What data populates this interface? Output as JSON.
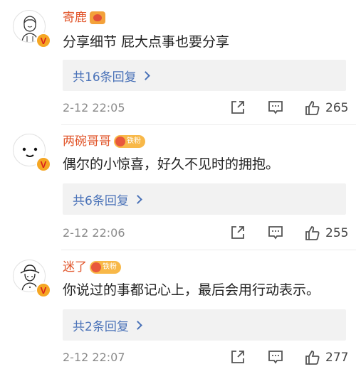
{
  "comments": [
    {
      "username": "寄鹿",
      "fan_badge_text": "",
      "content": "分享细节 屁大点事也要分享",
      "reply_label": "共16条回复",
      "time": "2-12 22:05",
      "likes": "265",
      "avatar": "sketch-person-avatar"
    },
    {
      "username": "两碗哥哥",
      "fan_badge_text": "铁粉",
      "content": "偶尔的小惊喜，好久不见时的拥抱。",
      "reply_label": "共6条回复",
      "time": "2-12 22:06",
      "likes": "255",
      "avatar": "smile-face-avatar"
    },
    {
      "username": "迷了",
      "fan_badge_text": "铁粉",
      "content": "你说过的事都记心上，最后会用行动表示。",
      "reply_label": "共2条回复",
      "time": "2-12 22:07",
      "likes": "277",
      "avatar": "hat-person-avatar"
    }
  ],
  "badge_letter": "V",
  "colors": {
    "username": "#e1552a",
    "link": "#4a72b8",
    "badge": "#f5a623"
  }
}
